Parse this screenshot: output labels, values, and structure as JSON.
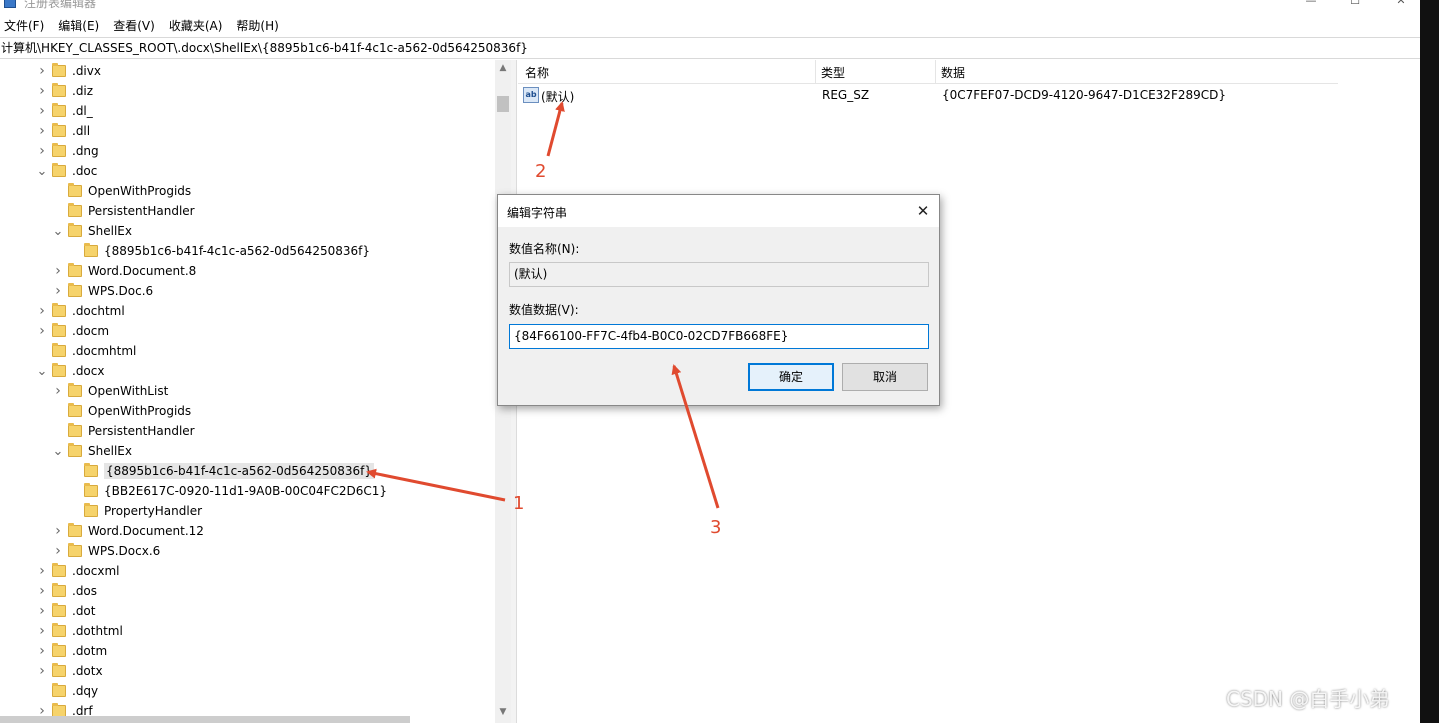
{
  "window": {
    "title": "注册表编辑器",
    "controls": {
      "minimize": "—",
      "maximize": "☐",
      "close": "✕"
    }
  },
  "menu": [
    "文件(F)",
    "编辑(E)",
    "查看(V)",
    "收藏夹(A)",
    "帮助(H)"
  ],
  "address": "计算机\\HKEY_CLASSES_ROOT\\.docx\\ShellEx\\{8895b1c6-b41f-4c1c-a562-0d564250836f}",
  "tree": [
    {
      "label": ".divx",
      "depth": 0,
      "expand": "collapsed"
    },
    {
      "label": ".diz",
      "depth": 0,
      "expand": "collapsed"
    },
    {
      "label": ".dl_",
      "depth": 0,
      "expand": "collapsed"
    },
    {
      "label": ".dll",
      "depth": 0,
      "expand": "collapsed"
    },
    {
      "label": ".dng",
      "depth": 0,
      "expand": "collapsed"
    },
    {
      "label": ".doc",
      "depth": 0,
      "expand": "expanded"
    },
    {
      "label": "OpenWithProgids",
      "depth": 1,
      "expand": "none"
    },
    {
      "label": "PersistentHandler",
      "depth": 1,
      "expand": "none"
    },
    {
      "label": "ShellEx",
      "depth": 1,
      "expand": "expanded"
    },
    {
      "label": "{8895b1c6-b41f-4c1c-a562-0d564250836f}",
      "depth": 2,
      "expand": "none"
    },
    {
      "label": "Word.Document.8",
      "depth": 1,
      "expand": "collapsed"
    },
    {
      "label": "WPS.Doc.6",
      "depth": 1,
      "expand": "collapsed"
    },
    {
      "label": ".dochtml",
      "depth": 0,
      "expand": "collapsed"
    },
    {
      "label": ".docm",
      "depth": 0,
      "expand": "collapsed"
    },
    {
      "label": ".docmhtml",
      "depth": 0,
      "expand": "none"
    },
    {
      "label": ".docx",
      "depth": 0,
      "expand": "expanded"
    },
    {
      "label": "OpenWithList",
      "depth": 1,
      "expand": "collapsed"
    },
    {
      "label": "OpenWithProgids",
      "depth": 1,
      "expand": "none"
    },
    {
      "label": "PersistentHandler",
      "depth": 1,
      "expand": "none"
    },
    {
      "label": "ShellEx",
      "depth": 1,
      "expand": "expanded"
    },
    {
      "label": "{8895b1c6-b41f-4c1c-a562-0d564250836f}",
      "depth": 2,
      "expand": "none",
      "selected": true
    },
    {
      "label": "{BB2E617C-0920-11d1-9A0B-00C04FC2D6C1}",
      "depth": 2,
      "expand": "none"
    },
    {
      "label": "PropertyHandler",
      "depth": 2,
      "expand": "none"
    },
    {
      "label": "Word.Document.12",
      "depth": 1,
      "expand": "collapsed"
    },
    {
      "label": "WPS.Docx.6",
      "depth": 1,
      "expand": "collapsed"
    },
    {
      "label": ".docxml",
      "depth": 0,
      "expand": "collapsed"
    },
    {
      "label": ".dos",
      "depth": 0,
      "expand": "collapsed"
    },
    {
      "label": ".dot",
      "depth": 0,
      "expand": "collapsed"
    },
    {
      "label": ".dothtml",
      "depth": 0,
      "expand": "collapsed"
    },
    {
      "label": ".dotm",
      "depth": 0,
      "expand": "collapsed"
    },
    {
      "label": ".dotx",
      "depth": 0,
      "expand": "collapsed"
    },
    {
      "label": ".dqy",
      "depth": 0,
      "expand": "none"
    },
    {
      "label": ".drf",
      "depth": 0,
      "expand": "collapsed"
    }
  ],
  "list": {
    "headers": {
      "name": "名称",
      "type": "类型",
      "data": "数据"
    },
    "rows": [
      {
        "icon": "ab",
        "name": "(默认)",
        "type": "REG_SZ",
        "data": "{0C7FEF07-DCD9-4120-9647-D1CE32F289CD}"
      }
    ]
  },
  "dialog": {
    "title": "编辑字符串",
    "close": "✕",
    "name_label": "数值名称(N):",
    "name_value": "(默认)",
    "data_label": "数值数据(V):",
    "data_value": "{84F66100-FF7C-4fb4-B0C0-02CD7FB668FE}",
    "ok": "确定",
    "cancel": "取消"
  },
  "annotations": {
    "color": "#e04a2f",
    "labels": [
      "1",
      "2",
      "3"
    ]
  },
  "watermark": "CSDN @白手小弟"
}
